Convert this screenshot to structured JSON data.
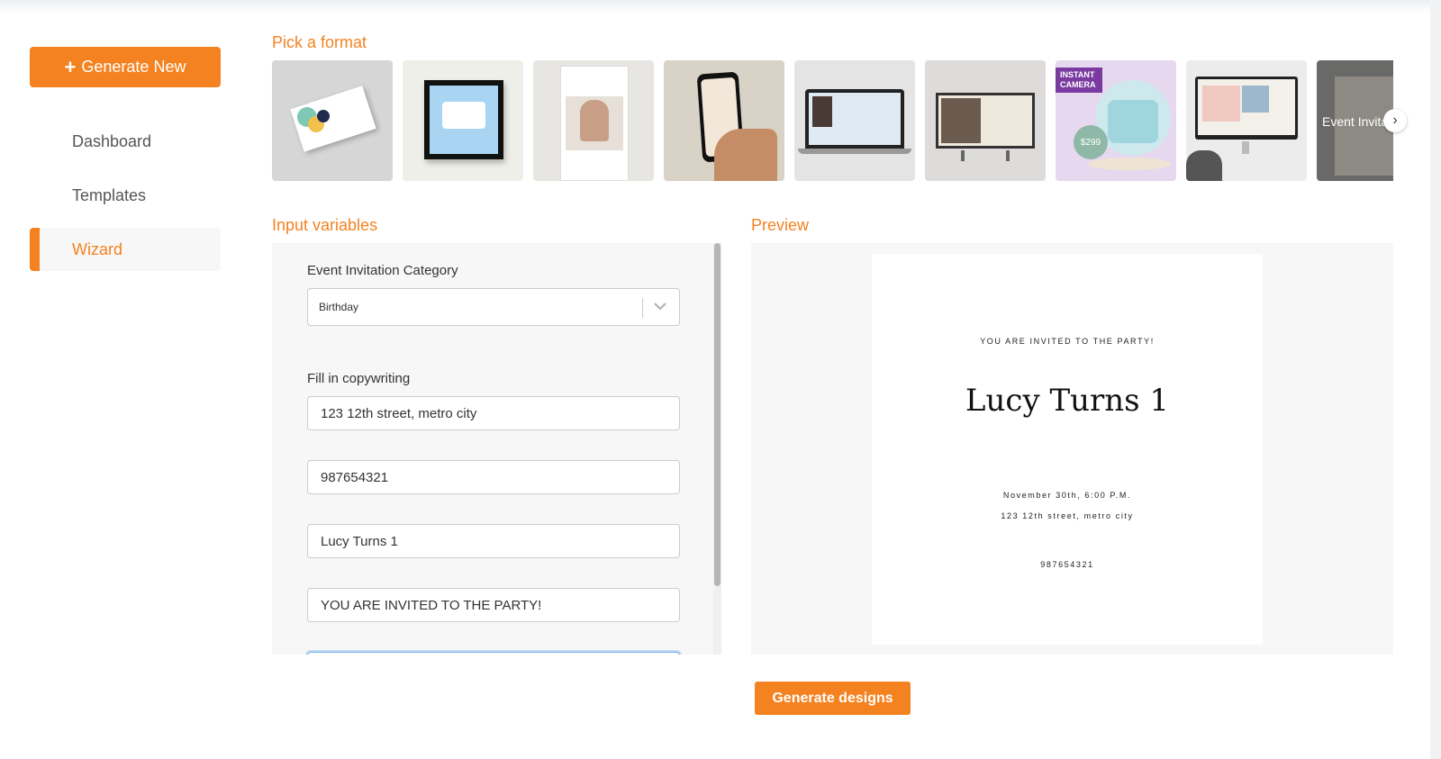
{
  "sidebar": {
    "generate_new": "Generate New",
    "items": [
      {
        "label": "Dashboard"
      },
      {
        "label": "Templates"
      },
      {
        "label": "Wizard",
        "active": true
      }
    ]
  },
  "formats": {
    "title": "Pick a format",
    "items": [
      {
        "name": "business-card"
      },
      {
        "name": "framed-quote"
      },
      {
        "name": "instagram-post"
      },
      {
        "name": "phone-story"
      },
      {
        "name": "laptop-website"
      },
      {
        "name": "tv-display"
      },
      {
        "name": "instant-camera-ad",
        "text": "INSTANT CAMERA",
        "price": "$299"
      },
      {
        "name": "desktop-banner"
      },
      {
        "name": "event-invitation",
        "label": "Event Invita"
      }
    ]
  },
  "inputs": {
    "title": "Input variables",
    "category_label": "Event Invitation Category",
    "category_value": "Birthday",
    "copy_label": "Fill in copywriting",
    "fields": [
      "123 12th street, metro city",
      "987654321",
      "Lucy Turns 1",
      "YOU ARE INVITED TO THE PARTY!"
    ]
  },
  "preview": {
    "title": "Preview",
    "headline": "YOU ARE INVITED TO THE PARTY!",
    "name": "Lucy Turns 1",
    "date": "November 30th, 6:00 P.M.",
    "address": "123 12th street, metro city",
    "phone": "987654321"
  },
  "actions": {
    "generate_designs": "Generate designs"
  },
  "colors": {
    "accent": "#f58220",
    "panel_bg": "#f7f7f7"
  }
}
